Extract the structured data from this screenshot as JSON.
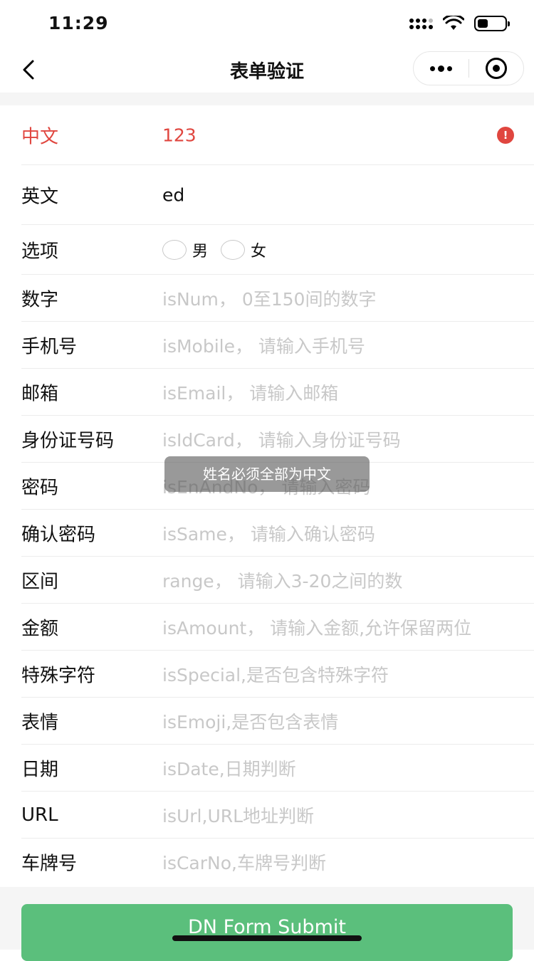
{
  "status_bar": {
    "time": "11:29"
  },
  "nav": {
    "title": "表单验证"
  },
  "form": {
    "rows": [
      {
        "label": "中文",
        "value": "123",
        "error": true
      },
      {
        "label": "英文",
        "value": "ed"
      },
      {
        "label": "选项",
        "options": [
          "男",
          "女"
        ]
      },
      {
        "label": "数字",
        "placeholder": "isNum， 0至150间的数字"
      },
      {
        "label": "手机号",
        "placeholder": "isMobile， 请输入手机号"
      },
      {
        "label": "邮箱",
        "placeholder": "isEmail， 请输入邮箱"
      },
      {
        "label": "身份证号码",
        "placeholder": "isIdCard， 请输入身份证号码"
      },
      {
        "label": "密码",
        "placeholder": "isEnAndNo， 请输入密码"
      },
      {
        "label": "确认密码",
        "placeholder": "isSame， 请输入确认密码"
      },
      {
        "label": "区间",
        "placeholder": "range， 请输入3-20之间的数"
      },
      {
        "label": "金额",
        "placeholder": "isAmount， 请输入金额,允许保留两位"
      },
      {
        "label": "特殊字符",
        "placeholder": "isSpecial,是否包含特殊字符"
      },
      {
        "label": "表情",
        "placeholder": "isEmoji,是否包含表情"
      },
      {
        "label": "日期",
        "placeholder": "isDate,日期判断"
      },
      {
        "label": "URL",
        "placeholder": "isUrl,URL地址判断"
      },
      {
        "label": "车牌号",
        "placeholder": "isCarNo,车牌号判断"
      }
    ]
  },
  "toast": {
    "message": "姓名必须全部为中文"
  },
  "submit": {
    "label": "DN Form Submit"
  },
  "colors": {
    "error": "#e0463f",
    "submit": "#5bbf7c"
  }
}
